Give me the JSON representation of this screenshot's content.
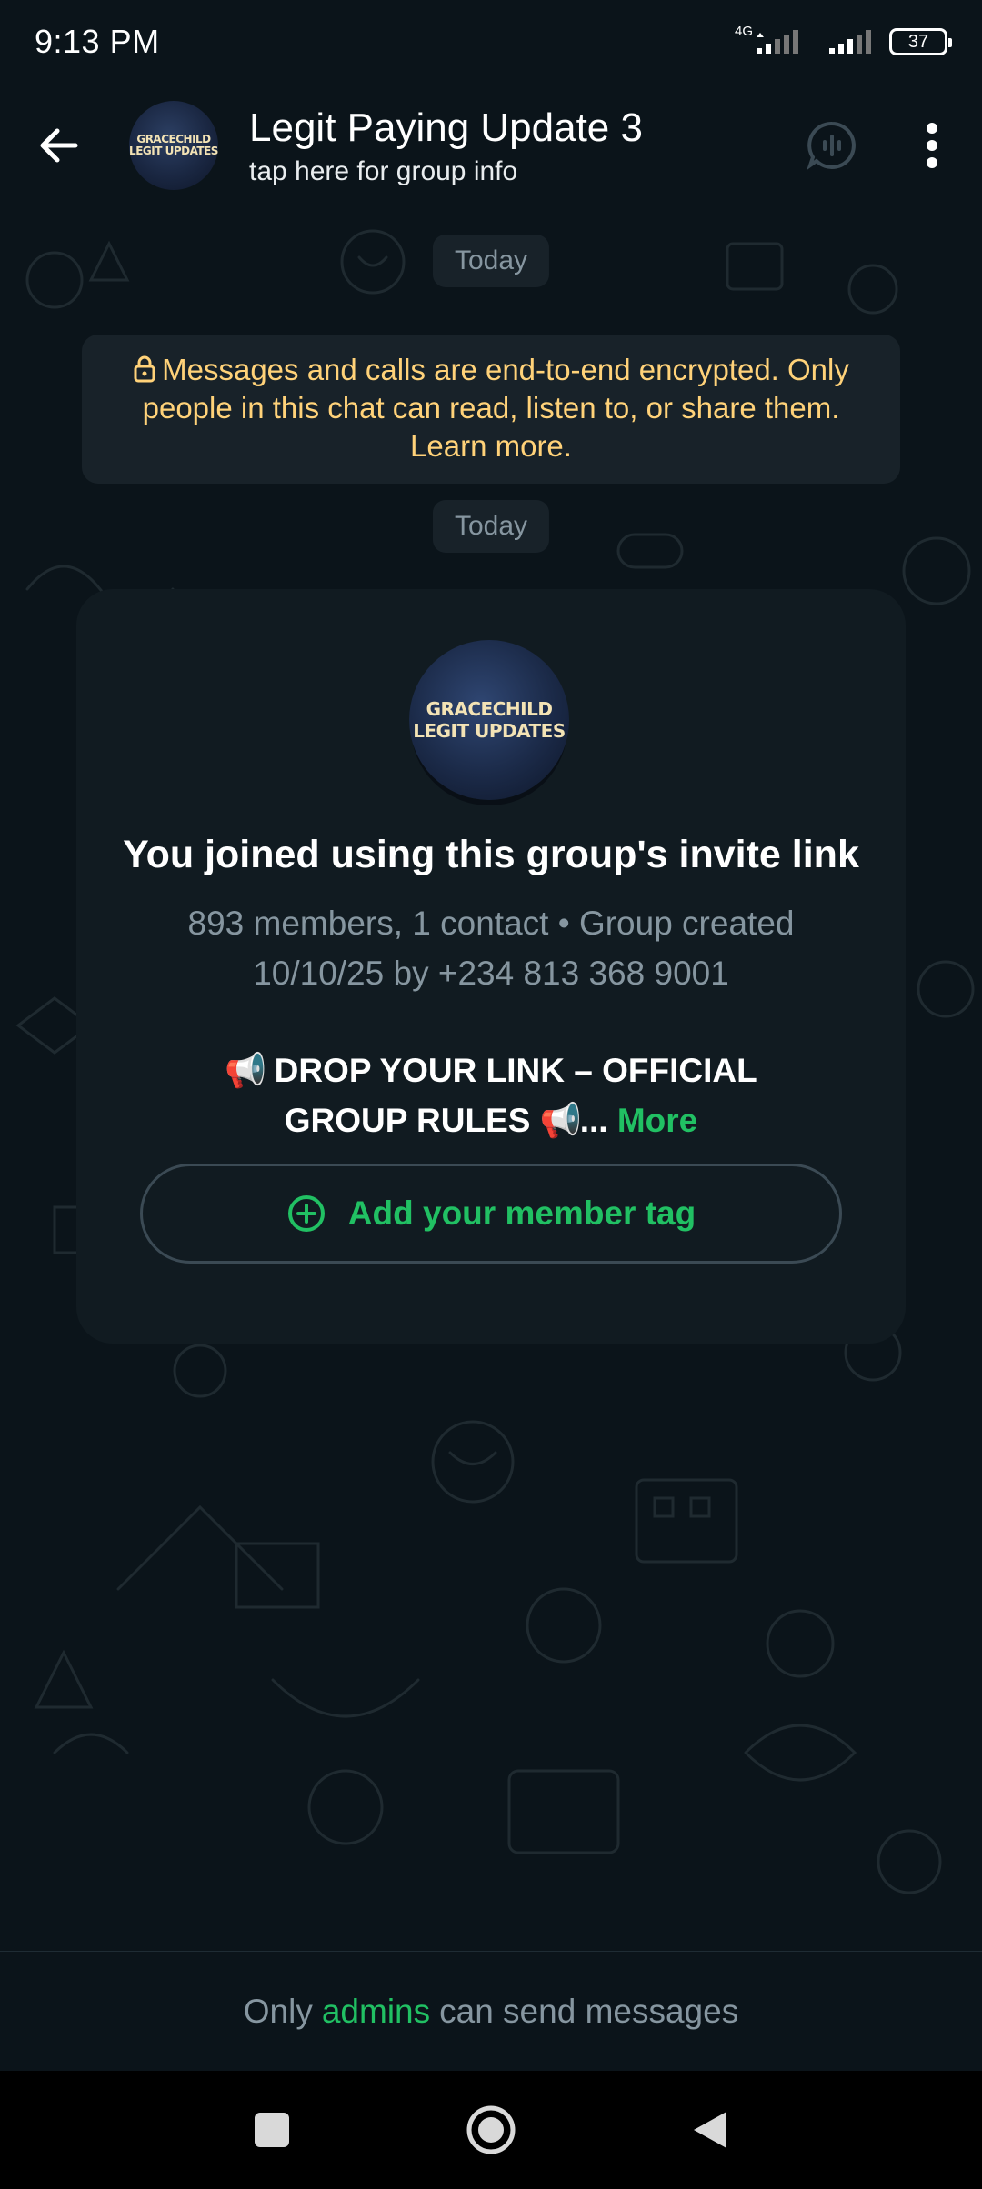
{
  "status_bar": {
    "time": "9:13 PM",
    "network": "4G",
    "battery": "37"
  },
  "header": {
    "title": "Legit Paying Update 3",
    "subtitle": "tap here for group info",
    "avatar_text_line1": "GRACECHILD",
    "avatar_text_line2": "LEGIT UPDATES",
    "icons": [
      "back-arrow-icon",
      "voice-chat-icon",
      "more-vert-icon"
    ]
  },
  "chat": {
    "date_label_1": "Today",
    "encryption_notice_text": "Messages and calls are end-to-end encrypted. Only people in this chat can read, listen to, or share them. Learn more.",
    "date_label_2": "Today",
    "card": {
      "avatar_text_line1": "GRACECHILD",
      "avatar_text_line2": "LEGIT UPDATES",
      "join_title": "You joined using this group's invite link",
      "meta_text": "893 members, 1 contact • Group created 10/10/25 by +234 813 368 9001",
      "description_emoji": "📢",
      "description_text": "DROP YOUR LINK – OFFICIAL GROUP RULES",
      "description_ellipsis": "...",
      "more_label": "More",
      "member_tag_label": "Add your member tag"
    }
  },
  "footer": {
    "prefix": "Only",
    "admins_label": "admins",
    "suffix": "can send messages"
  },
  "colors": {
    "background": "#0b141a",
    "bubble": "#182229",
    "card": "#111b21",
    "accent_green": "#21c063",
    "encryption_text": "#ffd279",
    "muted_text": "#8696a0"
  }
}
